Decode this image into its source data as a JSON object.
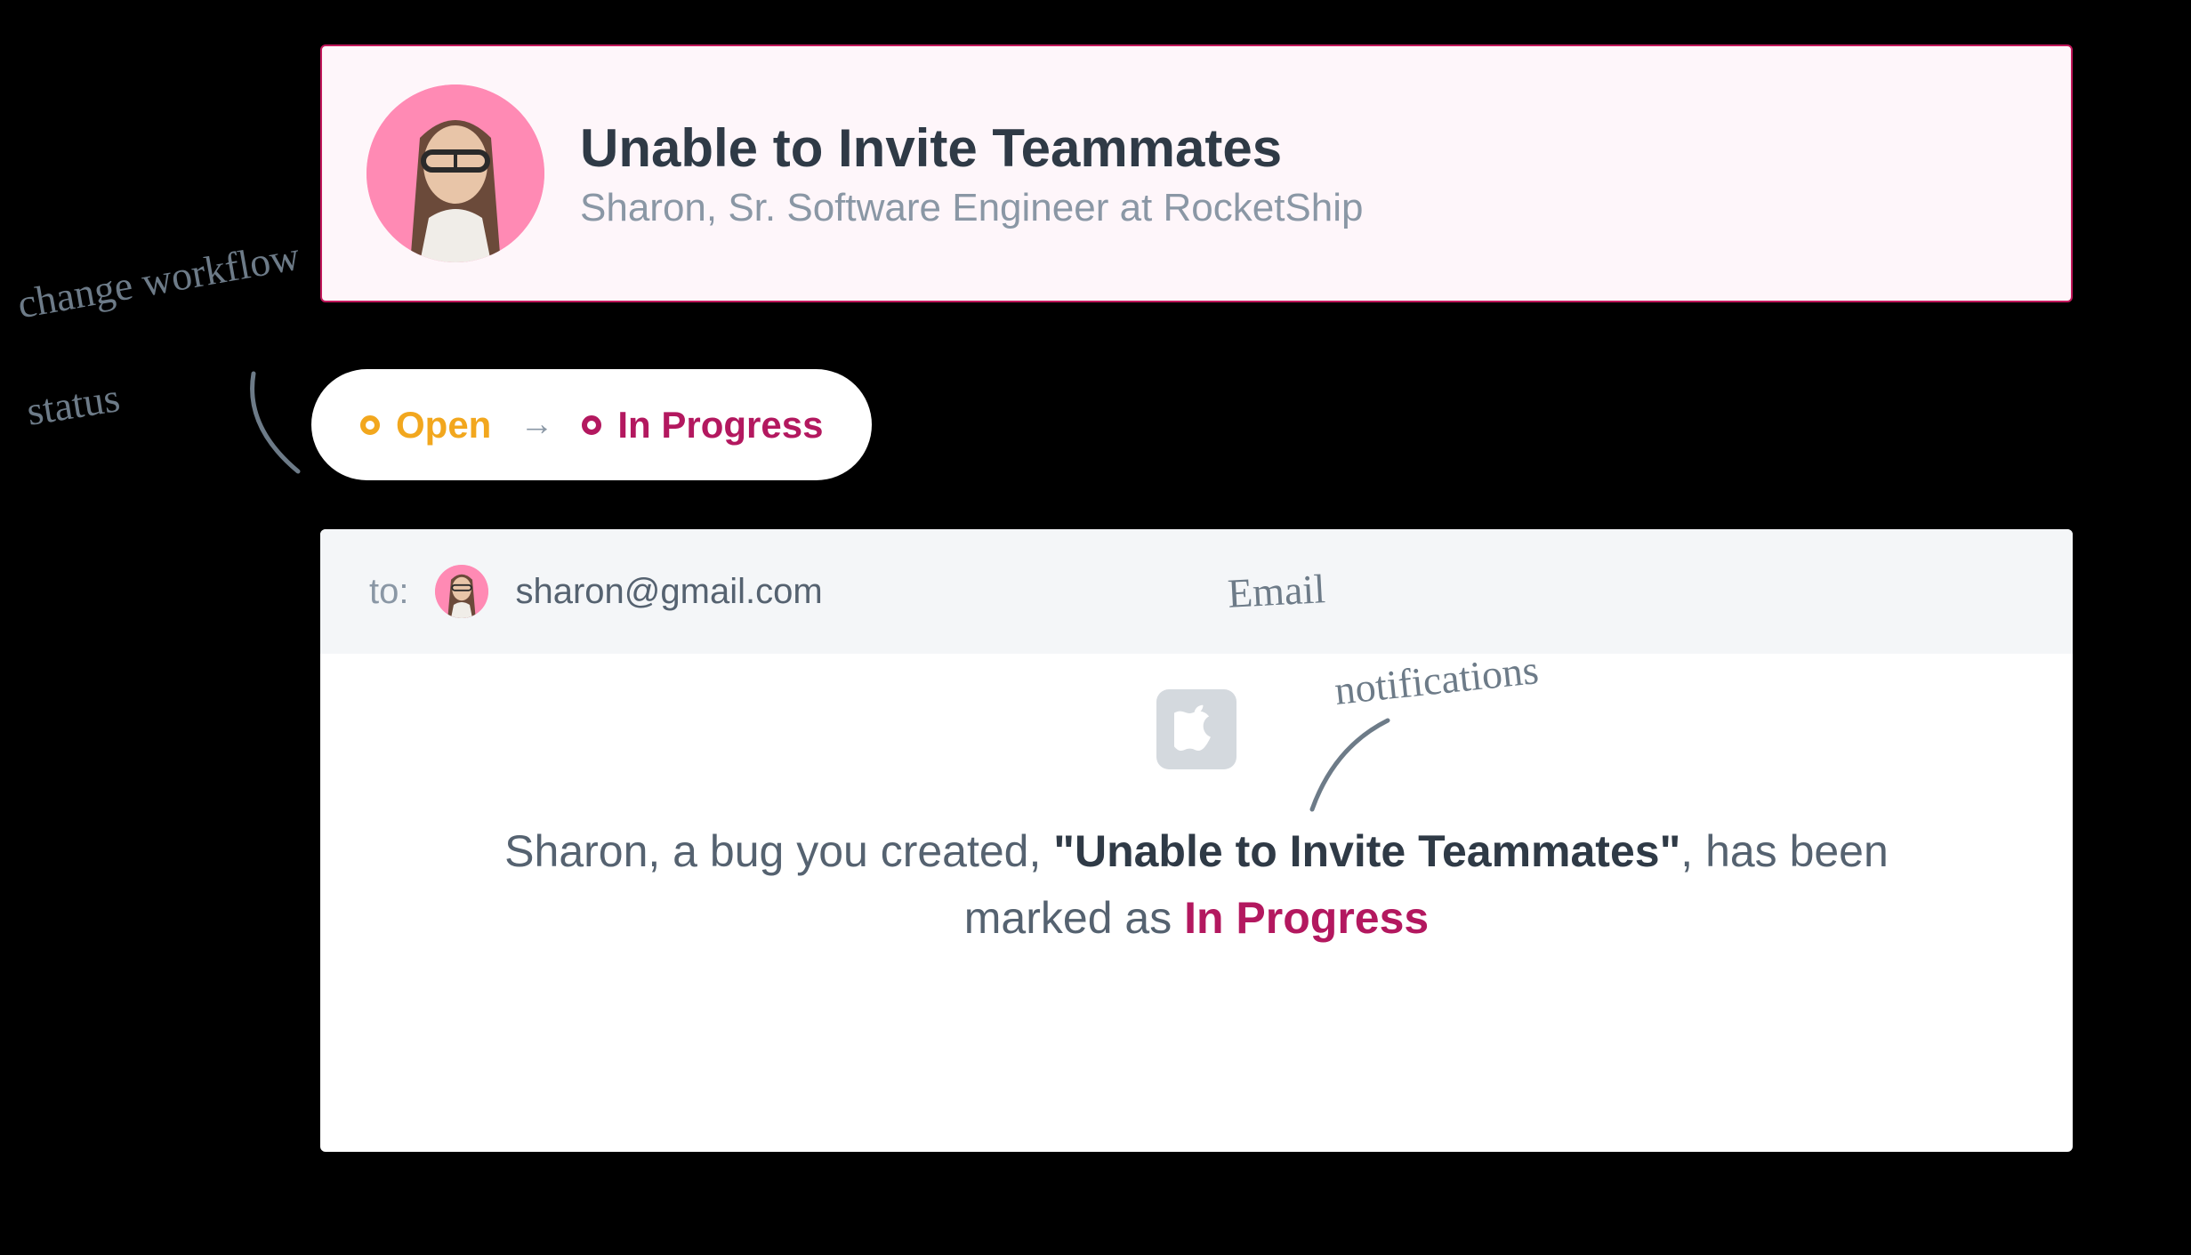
{
  "ticket": {
    "title": "Unable to Invite Teammates",
    "subtitle": "Sharon, Sr. Software Engineer at RocketShip"
  },
  "status": {
    "from": "Open",
    "to": "In Progress"
  },
  "annotations": {
    "workflow": "change workflow",
    "status": "status",
    "email": "Email",
    "notifications": "notifications"
  },
  "email": {
    "to_label": "to:",
    "address": "sharon@gmail.com",
    "message": {
      "pre": "Sharon, a bug you created, ",
      "bug_title": "\"Unable to Invite Teammates\"",
      "mid": ", has been marked as ",
      "status": "In Progress"
    }
  },
  "colors": {
    "open": "#f2a71e",
    "in_progress": "#b3185f",
    "avatar_bg": "#ff8ab4"
  }
}
